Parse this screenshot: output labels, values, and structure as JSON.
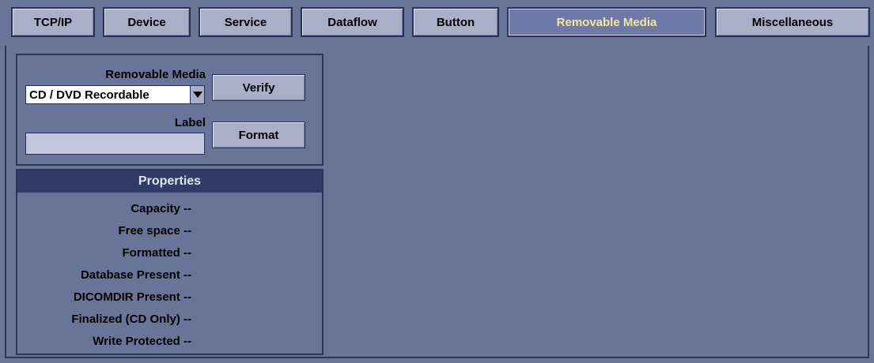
{
  "tabs": [
    {
      "label": "TCP/IP",
      "active": false
    },
    {
      "label": "Device",
      "active": false
    },
    {
      "label": "Service",
      "active": false
    },
    {
      "label": "Dataflow",
      "active": false
    },
    {
      "label": "Button",
      "active": false
    },
    {
      "label": "Removable Media",
      "active": true
    },
    {
      "label": "Miscellaneous",
      "active": false
    }
  ],
  "media": {
    "media_label": "Removable Media",
    "media_value": "CD / DVD Recordable",
    "label_label": "Label",
    "label_value": "",
    "verify_button": "Verify",
    "format_button": "Format"
  },
  "properties": {
    "title": "Properties",
    "rows": [
      "Capacity --",
      "Free space --",
      "Formatted --",
      "Database Present --",
      "DICOMDIR Present --",
      "Finalized (CD Only) --",
      "Write Protected --"
    ]
  },
  "colors": {
    "background": "#6a7398",
    "tab": "#a9aec9",
    "active_tab": "#6e7aa6",
    "active_tab_text": "#f3e6a0",
    "header": "#323a66"
  }
}
